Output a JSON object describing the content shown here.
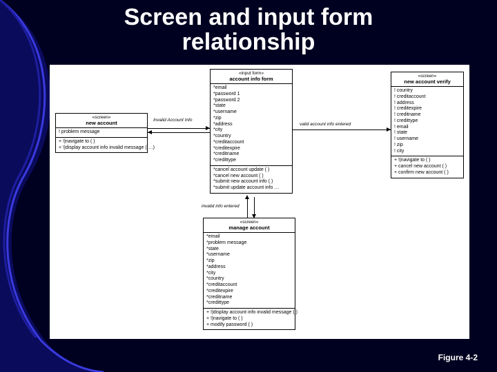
{
  "slide": {
    "title_line1": "Screen and input form",
    "title_line2": "relationship",
    "figure_caption": "Figure 4-2"
  },
  "boxes": {
    "new_account": {
      "stereo": "«screen»",
      "name": "new account",
      "attrs": [
        "! problem message"
      ],
      "ops": [
        "+ !|navigate to ( )",
        "+ !|display account info invalid message ( …)"
      ]
    },
    "account_info_form": {
      "stereo": "«input form»",
      "name": "account info form",
      "attrs": [
        "*email",
        "*password 1",
        "*password 2",
        "*state",
        "*username",
        "*zip",
        "*address",
        "*city",
        "*country",
        "*creditaccount",
        "*creditexpire",
        "*creditname",
        "*credittype"
      ],
      "ops": [
        "*cancel account update ( )",
        "*cancel new account ( )",
        "*submit new account info ( )",
        "*submit update account info …"
      ]
    },
    "new_account_verify": {
      "stereo": "«screen»",
      "name": "new account verify",
      "attrs": [
        "! country",
        "! creditaccount",
        "! address",
        "! creditexpire",
        "! creditname",
        "! credittype",
        "! email",
        "! state",
        "! username",
        "! zip",
        "! city"
      ],
      "ops": [
        "+ !|navigate to ( )",
        "+ cancel new account ( )",
        "+ confirm new account ( )"
      ]
    },
    "manage_account": {
      "stereo": "«screen»",
      "name": "manage account",
      "attrs": [
        "*email",
        "*problem message",
        "*state",
        "*username",
        "*zip",
        "*address",
        "*city",
        "*country",
        "*creditaccount",
        "*creditexpire",
        "*creditname",
        "*credittype"
      ],
      "ops": [
        "+ !|display account info invalid message ( )",
        "+ !|navigate to ( )",
        "+ modify password ( )"
      ]
    }
  },
  "edges": {
    "e1": "Invalid Account Info",
    "e2": "valid account info entered",
    "e3": "invalid info entered"
  }
}
